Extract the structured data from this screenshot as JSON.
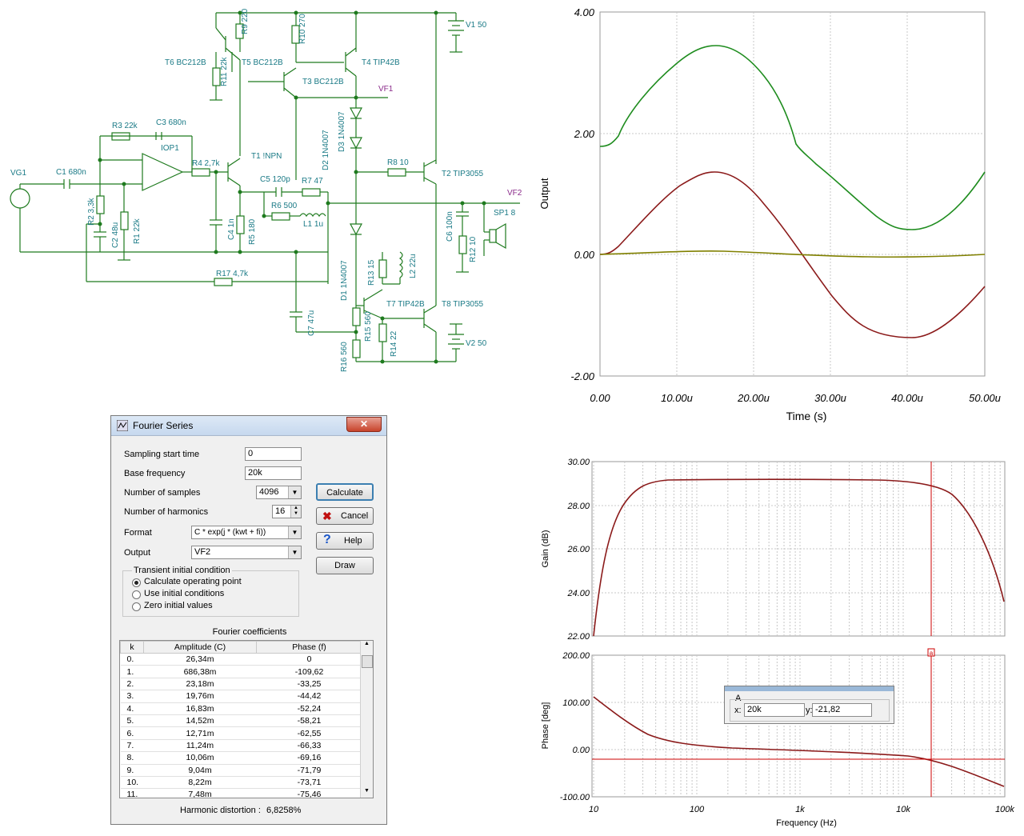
{
  "schematic": {
    "components": [
      "R9 220",
      "R10 270",
      "V1 50",
      "T6 BC212B",
      "T5 BC212B",
      "T4 TIP42B",
      "R11 22k",
      "T3 BC212B",
      "VF1",
      "R3 22k",
      "C3 680n",
      "IOP1",
      "D3 1N4007",
      "D2 1N4007",
      "VG1",
      "C1 680n",
      "R4 2,7k",
      "T1 !NPN",
      "R8 10",
      "T2 TIP3055",
      "C5 120p",
      "R7 47",
      "VF2",
      "R2 3,3k",
      "R6 500",
      "L1 1u",
      "SP1 8",
      "C2 48u",
      "R1 22k",
      "C4 1n",
      "R5 180",
      "C6 100n",
      "R12 10",
      "R13 15",
      "L2 22u",
      "R17 4,7k",
      "D1 1N4007",
      "T7 TIP42B",
      "T8 TIP3055",
      "C7 47u",
      "R15 560",
      "R14 22",
      "R16 560",
      "V2 50"
    ]
  },
  "time_chart": {
    "xlabel": "Time (s)",
    "ylabel": "Output",
    "x_ticks": [
      "0.00",
      "10.00u",
      "20.00u",
      "30.00u",
      "40.00u",
      "50.00u"
    ],
    "y_ticks": [
      "4.00",
      "2.00",
      "0.00",
      "-2.00"
    ]
  },
  "bode_chart": {
    "gain_ylabel": "Gain (dB)",
    "phase_ylabel": "Phase [deg]",
    "xlabel": "Frequency (Hz)",
    "gain_ticks": [
      "30.00",
      "28.00",
      "26.00",
      "24.00",
      "22.00"
    ],
    "phase_ticks": [
      "200.00",
      "100.00",
      "0.00",
      "-100.00"
    ],
    "x_ticks": [
      "10",
      "100",
      "1k",
      "10k",
      "100k"
    ],
    "cursor": {
      "label": "A",
      "x_label": "x:",
      "x_value": "20k",
      "y_label": "y:",
      "y_value": "-21,82",
      "marker": "a"
    }
  },
  "dialog": {
    "title": "Fourier Series",
    "close_label": "✕",
    "sampling_start_label": "Sampling start time",
    "sampling_start_value": "0",
    "base_freq_label": "Base frequency",
    "base_freq_value": "20k",
    "num_samples_label": "Number of samples",
    "num_samples_value": "4096",
    "num_harmonics_label": "Number of harmonics",
    "num_harmonics_value": "16",
    "format_label": "Format",
    "format_value": "C * exp(j * (kwt + fi))",
    "output_label": "Output",
    "output_value": "VF2",
    "calculate_label": "Calculate",
    "cancel_label": "Cancel",
    "help_label": "Help",
    "draw_label": "Draw",
    "group_title": "Transient initial condition",
    "radio_options": [
      "Calculate operating point",
      "Use initial conditions",
      "Zero initial values"
    ],
    "selected_radio": 0,
    "coef_title": "Fourier coefficients",
    "columns": [
      "k",
      "Amplitude (C)",
      "Phase (f)"
    ],
    "rows": [
      [
        "0.",
        "26,34m",
        "0"
      ],
      [
        "1.",
        "686,38m",
        "-109,62"
      ],
      [
        "2.",
        "23,18m",
        "-33,25"
      ],
      [
        "3.",
        "19,76m",
        "-44,42"
      ],
      [
        "4.",
        "16,83m",
        "-52,24"
      ],
      [
        "5.",
        "14,52m",
        "-58,21"
      ],
      [
        "6.",
        "12,71m",
        "-62,55"
      ],
      [
        "7.",
        "11,24m",
        "-66,33"
      ],
      [
        "8.",
        "10,06m",
        "-69,16"
      ],
      [
        "9.",
        "9,04m",
        "-71,79"
      ],
      [
        "10.",
        "8,22m",
        "-73,71"
      ],
      [
        "11.",
        "7,48m",
        "-75,46"
      ]
    ],
    "distortion_label": "Harmonic distortion :",
    "distortion_value": "6,8258%"
  }
}
